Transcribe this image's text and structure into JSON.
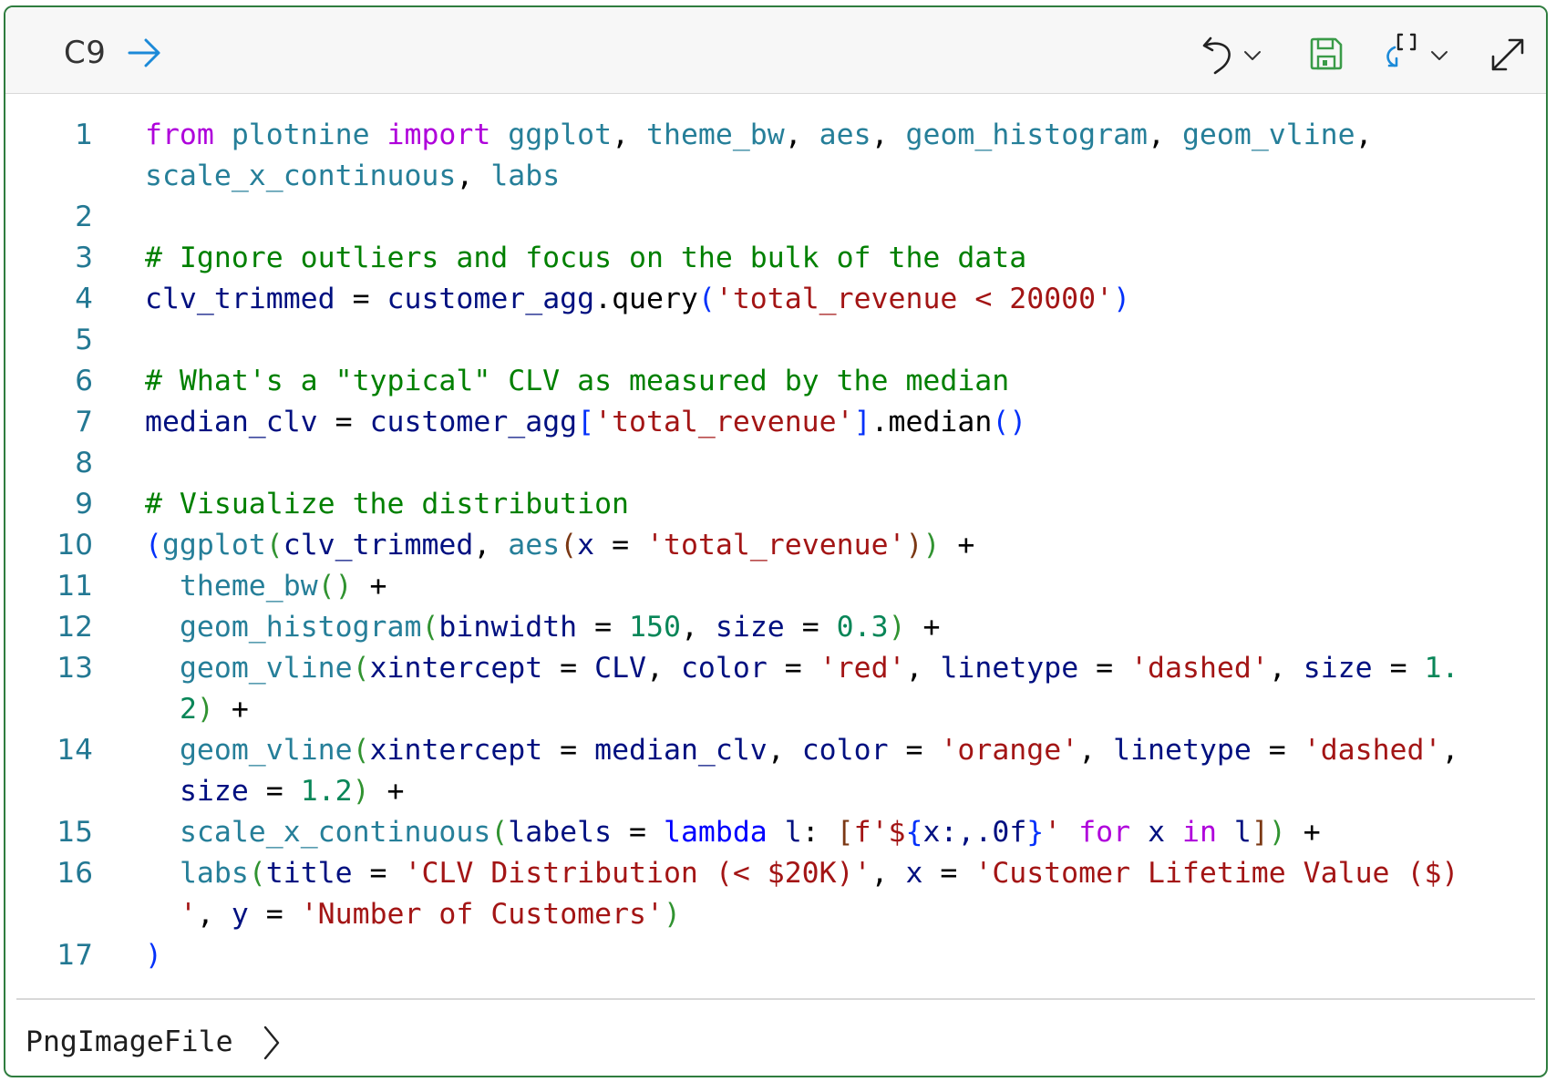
{
  "cell": {
    "label": "C9",
    "icons": {
      "run": "arrow-right-icon",
      "undo": "undo-icon",
      "save": "save-icon",
      "refresh": "refresh-variables-icon",
      "expand": "expand-icon"
    },
    "colors": {
      "border": "#2f7d3f",
      "run_arrow": "#1c8ad8",
      "save_icon": "#3a9b48",
      "line_numbers": "#237893"
    }
  },
  "code_lines": [
    {
      "n": "1",
      "tokens": [
        {
          "t": "from",
          "c": "kw"
        },
        {
          "t": " "
        },
        {
          "t": "plotnine",
          "c": "id"
        },
        {
          "t": " "
        },
        {
          "t": "import",
          "c": "kw"
        },
        {
          "t": " "
        },
        {
          "t": "ggplot",
          "c": "id"
        },
        {
          "t": ", "
        },
        {
          "t": "theme_bw",
          "c": "id"
        },
        {
          "t": ", "
        },
        {
          "t": "aes",
          "c": "id"
        },
        {
          "t": ", "
        },
        {
          "t": "geom_histogram",
          "c": "id"
        },
        {
          "t": ", "
        },
        {
          "t": "geom_vline",
          "c": "id"
        },
        {
          "t": ","
        }
      ]
    },
    {
      "n": "",
      "tokens": [
        {
          "t": "scale_x_continuous",
          "c": "id"
        },
        {
          "t": ", "
        },
        {
          "t": "labs",
          "c": "id"
        }
      ]
    },
    {
      "n": "2",
      "tokens": []
    },
    {
      "n": "3",
      "tokens": [
        {
          "t": "# Ignore outliers and focus on the bulk of the data",
          "c": "cm"
        }
      ]
    },
    {
      "n": "4",
      "tokens": [
        {
          "t": "clv_trimmed",
          "c": "vr"
        },
        {
          "t": " = "
        },
        {
          "t": "customer_agg",
          "c": "vr"
        },
        {
          "t": ".query"
        },
        {
          "t": "(",
          "c": "b1"
        },
        {
          "t": "'total_revenue < 20000'",
          "c": "st"
        },
        {
          "t": ")",
          "c": "b1"
        }
      ]
    },
    {
      "n": "5",
      "tokens": []
    },
    {
      "n": "6",
      "tokens": [
        {
          "t": "# What's a \"typical\" CLV as measured by the median",
          "c": "cm"
        }
      ]
    },
    {
      "n": "7",
      "tokens": [
        {
          "t": "median_clv",
          "c": "vr"
        },
        {
          "t": " = "
        },
        {
          "t": "customer_agg",
          "c": "vr"
        },
        {
          "t": "[",
          "c": "b1"
        },
        {
          "t": "'total_revenue'",
          "c": "st"
        },
        {
          "t": "]",
          "c": "b1"
        },
        {
          "t": ".median"
        },
        {
          "t": "()",
          "c": "b1"
        }
      ]
    },
    {
      "n": "8",
      "tokens": []
    },
    {
      "n": "9",
      "tokens": [
        {
          "t": "# Visualize the distribution",
          "c": "cm"
        }
      ]
    },
    {
      "n": "10",
      "tokens": [
        {
          "t": "(",
          "c": "b1"
        },
        {
          "t": "ggplot",
          "c": "id"
        },
        {
          "t": "(",
          "c": "b2"
        },
        {
          "t": "clv_trimmed",
          "c": "vr"
        },
        {
          "t": ", "
        },
        {
          "t": "aes",
          "c": "id"
        },
        {
          "t": "(",
          "c": "b3"
        },
        {
          "t": "x",
          "c": "vr"
        },
        {
          "t": " = "
        },
        {
          "t": "'total_revenue'",
          "c": "st"
        },
        {
          "t": ")",
          "c": "b3"
        },
        {
          "t": ")",
          "c": "b2"
        },
        {
          "t": " +"
        }
      ]
    },
    {
      "n": "11",
      "tokens": [
        {
          "t": "  "
        },
        {
          "t": "theme_bw",
          "c": "id"
        },
        {
          "t": "()",
          "c": "b2"
        },
        {
          "t": " +"
        }
      ]
    },
    {
      "n": "12",
      "tokens": [
        {
          "t": "  "
        },
        {
          "t": "geom_histogram",
          "c": "id"
        },
        {
          "t": "(",
          "c": "b2"
        },
        {
          "t": "binwidth",
          "c": "vr"
        },
        {
          "t": " = "
        },
        {
          "t": "150",
          "c": "nu"
        },
        {
          "t": ", "
        },
        {
          "t": "size",
          "c": "vr"
        },
        {
          "t": " = "
        },
        {
          "t": "0.3",
          "c": "nu"
        },
        {
          "t": ")",
          "c": "b2"
        },
        {
          "t": " +"
        }
      ]
    },
    {
      "n": "13",
      "tokens": [
        {
          "t": "  "
        },
        {
          "t": "geom_vline",
          "c": "id"
        },
        {
          "t": "(",
          "c": "b2"
        },
        {
          "t": "xintercept",
          "c": "vr"
        },
        {
          "t": " = "
        },
        {
          "t": "CLV",
          "c": "vr"
        },
        {
          "t": ", "
        },
        {
          "t": "color",
          "c": "vr"
        },
        {
          "t": " = "
        },
        {
          "t": "'red'",
          "c": "st"
        },
        {
          "t": ", "
        },
        {
          "t": "linetype",
          "c": "vr"
        },
        {
          "t": " = "
        },
        {
          "t": "'dashed'",
          "c": "st"
        },
        {
          "t": ", "
        },
        {
          "t": "size",
          "c": "vr"
        },
        {
          "t": " = "
        },
        {
          "t": "1.",
          "c": "nu"
        }
      ]
    },
    {
      "n": "",
      "tokens": [
        {
          "t": "  "
        },
        {
          "t": "2",
          "c": "nu"
        },
        {
          "t": ")",
          "c": "b2"
        },
        {
          "t": " +"
        }
      ]
    },
    {
      "n": "14",
      "tokens": [
        {
          "t": "  "
        },
        {
          "t": "geom_vline",
          "c": "id"
        },
        {
          "t": "(",
          "c": "b2"
        },
        {
          "t": "xintercept",
          "c": "vr"
        },
        {
          "t": " = "
        },
        {
          "t": "median_clv",
          "c": "vr"
        },
        {
          "t": ", "
        },
        {
          "t": "color",
          "c": "vr"
        },
        {
          "t": " = "
        },
        {
          "t": "'orange'",
          "c": "st"
        },
        {
          "t": ", "
        },
        {
          "t": "linetype",
          "c": "vr"
        },
        {
          "t": " = "
        },
        {
          "t": "'dashed'",
          "c": "st"
        },
        {
          "t": ","
        }
      ]
    },
    {
      "n": "",
      "tokens": [
        {
          "t": "  "
        },
        {
          "t": "size",
          "c": "vr"
        },
        {
          "t": " = "
        },
        {
          "t": "1.2",
          "c": "nu"
        },
        {
          "t": ")",
          "c": "b2"
        },
        {
          "t": " +"
        }
      ]
    },
    {
      "n": "15",
      "tokens": [
        {
          "t": "  "
        },
        {
          "t": "scale_x_continuous",
          "c": "id"
        },
        {
          "t": "(",
          "c": "b2"
        },
        {
          "t": "labels",
          "c": "vr"
        },
        {
          "t": " = "
        },
        {
          "t": "lambda",
          "c": "kwb"
        },
        {
          "t": " "
        },
        {
          "t": "l",
          "c": "vr"
        },
        {
          "t": ": "
        },
        {
          "t": "[",
          "c": "b3"
        },
        {
          "t": "f'$",
          "c": "st"
        },
        {
          "t": "{",
          "c": "b1"
        },
        {
          "t": "x:,.0f",
          "c": "vr"
        },
        {
          "t": "}",
          "c": "b1"
        },
        {
          "t": "'",
          "c": "st"
        },
        {
          "t": " "
        },
        {
          "t": "for",
          "c": "kw"
        },
        {
          "t": " "
        },
        {
          "t": "x",
          "c": "vr"
        },
        {
          "t": " "
        },
        {
          "t": "in",
          "c": "kw"
        },
        {
          "t": " "
        },
        {
          "t": "l",
          "c": "vr"
        },
        {
          "t": "]",
          "c": "b3"
        },
        {
          "t": ")",
          "c": "b2"
        },
        {
          "t": " +"
        }
      ]
    },
    {
      "n": "16",
      "tokens": [
        {
          "t": "  "
        },
        {
          "t": "labs",
          "c": "id"
        },
        {
          "t": "(",
          "c": "b2"
        },
        {
          "t": "title",
          "c": "vr"
        },
        {
          "t": " = "
        },
        {
          "t": "'CLV Distribution (< $20K)'",
          "c": "st"
        },
        {
          "t": ", "
        },
        {
          "t": "x",
          "c": "vr"
        },
        {
          "t": " = "
        },
        {
          "t": "'Customer Lifetime Value ($)",
          "c": "st"
        }
      ]
    },
    {
      "n": "",
      "tokens": [
        {
          "t": "  "
        },
        {
          "t": "'",
          "c": "st"
        },
        {
          "t": ", "
        },
        {
          "t": "y",
          "c": "vr"
        },
        {
          "t": " = "
        },
        {
          "t": "'Number of Customers'",
          "c": "st"
        },
        {
          "t": ")",
          "c": "b2"
        }
      ]
    },
    {
      "n": "17",
      "tokens": [
        {
          "t": ")",
          "c": "b1"
        }
      ]
    }
  ],
  "output": {
    "label": "PngImageFile",
    "icon": "chevron-right-icon"
  }
}
